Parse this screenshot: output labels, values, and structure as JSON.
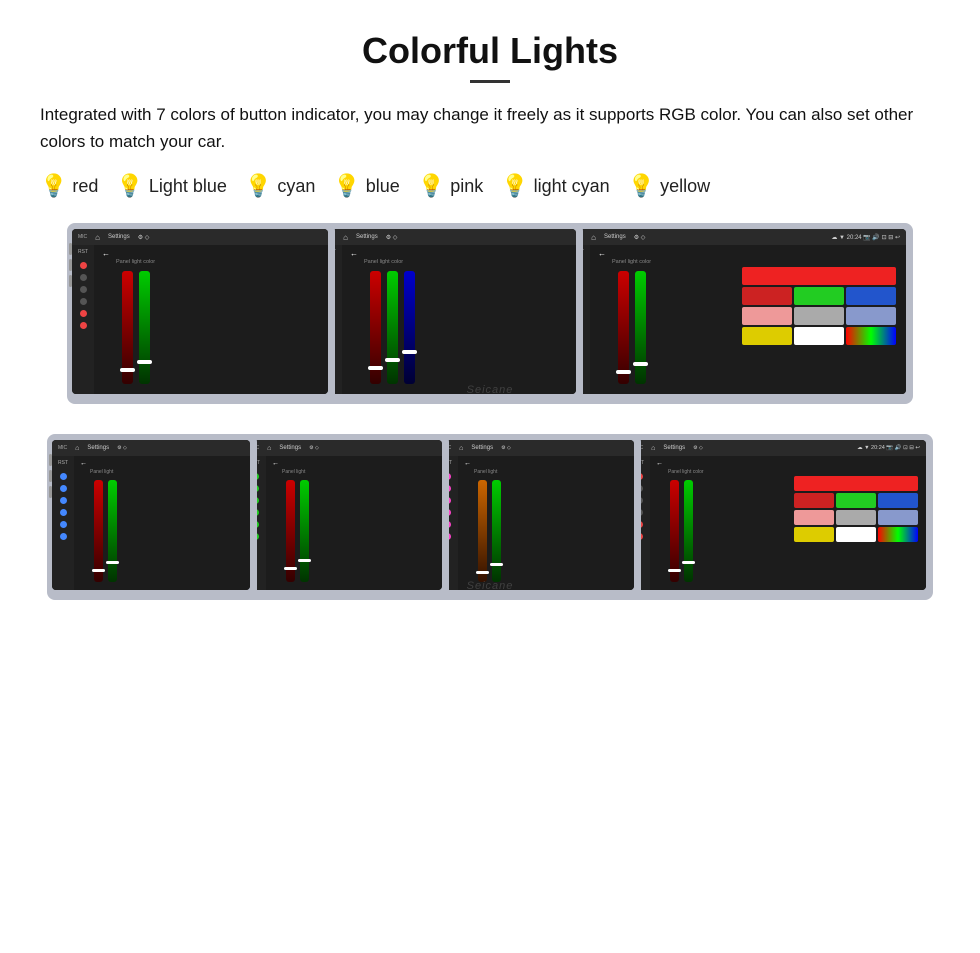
{
  "title": "Colorful Lights",
  "description": "Integrated with 7 colors of button indicator, you may change it freely as it supports RGB color. You can also set other colors to match your car.",
  "colors": [
    {
      "name": "red",
      "bulb": "🔴",
      "class": "bulb-red"
    },
    {
      "name": "Light blue",
      "bulb": "💡",
      "class": "bulb-lightblue"
    },
    {
      "name": "cyan",
      "bulb": "💡",
      "class": "bulb-cyan"
    },
    {
      "name": "blue",
      "bulb": "💡",
      "class": "bulb-blue"
    },
    {
      "name": "pink",
      "bulb": "💡",
      "class": "bulb-pink"
    },
    {
      "name": "light cyan",
      "bulb": "💡",
      "class": "bulb-lightcyan"
    },
    {
      "name": "yellow",
      "bulb": "💡",
      "class": "bulb-yellow"
    }
  ],
  "screen_label": "Panel light color",
  "settings_text": "Settings",
  "watermark1": "Seicane",
  "watermark2": "Seicane",
  "top_screens_count": 3,
  "bottom_screens_count": 4
}
